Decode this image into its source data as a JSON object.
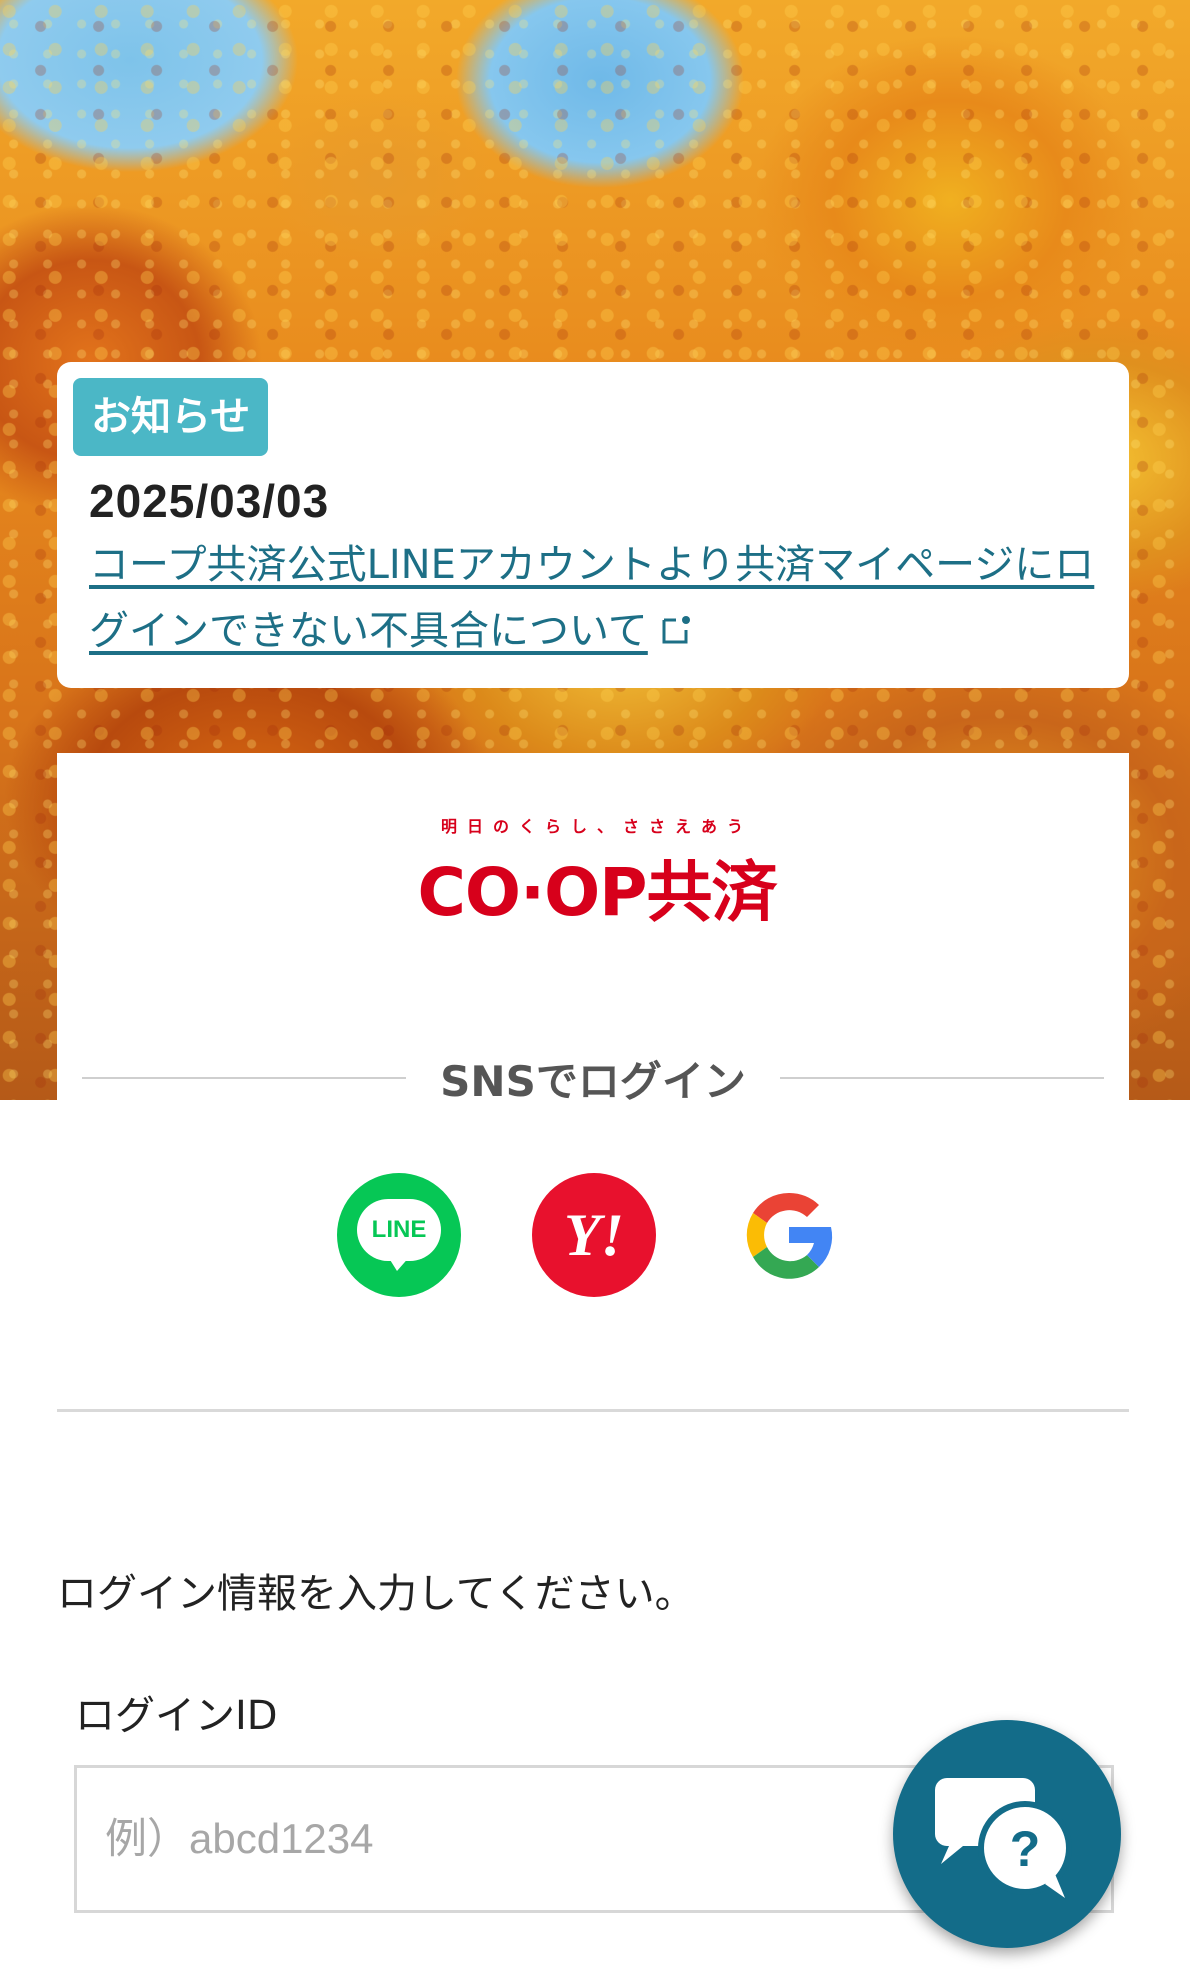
{
  "notice": {
    "badge": "お知らせ",
    "date": "2025/03/03",
    "link_text": "コープ共済公式LINEアカウントより共済マイページにログインできない不具合について",
    "badge_color": "#4bb7c6",
    "link_color": "#1d6f86"
  },
  "logo": {
    "tagline": "明日のくらし、ささえあう",
    "main": "CO·OP共済",
    "color": "#d7001b"
  },
  "sns": {
    "heading": "SNSでログイン",
    "buttons": [
      {
        "label": "LINE",
        "icon": "line-icon",
        "color": "#06c755"
      },
      {
        "label": "Y!",
        "icon": "yahoo-icon",
        "color": "#e8112d"
      },
      {
        "label": "G",
        "icon": "google-icon"
      }
    ]
  },
  "login": {
    "prompt": "ログイン情報を入力してください。",
    "id_label": "ログインID",
    "id_placeholder": "例）abcd1234"
  },
  "help": {
    "icon": "help-chat-icon",
    "glyph": "?",
    "color": "#136c89"
  }
}
